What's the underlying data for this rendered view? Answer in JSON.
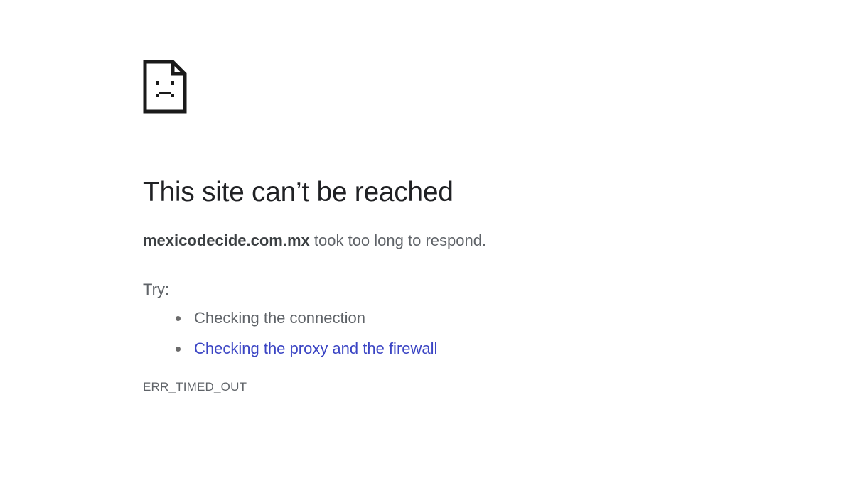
{
  "page": {
    "icon": "sad-page-icon",
    "title": "This site can’t be reached",
    "summary": {
      "host": "mexicodecide.com.mx",
      "message": " took too long to respond."
    },
    "try_label": "Try:",
    "suggestions": [
      {
        "label": "Checking the connection",
        "is_link": false
      },
      {
        "label": "Checking the proxy and the firewall",
        "is_link": true
      }
    ],
    "error_code": "ERR_TIMED_OUT",
    "colors": {
      "title": "#202124",
      "body_text": "#5f6368",
      "link": "#3b45c4"
    }
  }
}
